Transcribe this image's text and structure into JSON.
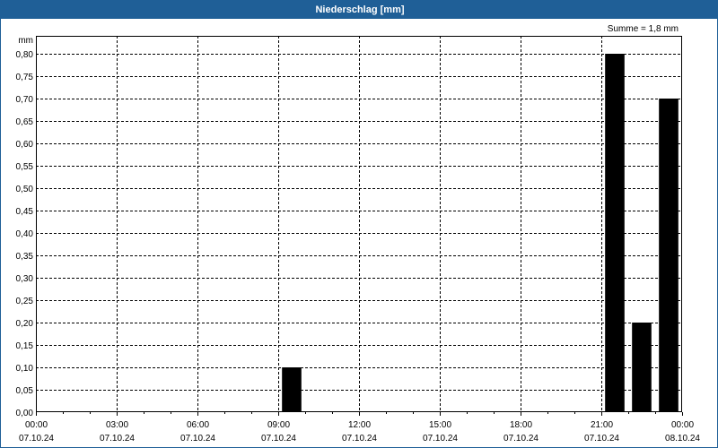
{
  "window": {
    "title": "Niederschlag [mm]"
  },
  "summary": {
    "text": "Summe = 1,8 mm"
  },
  "colors": {
    "titlebar": "#1f5f97",
    "bars": "#000000",
    "grid": "#000000"
  },
  "chart_data": {
    "type": "bar",
    "title": "Niederschlag [mm]",
    "ylabel": "mm",
    "xlabel": "",
    "ylim": [
      0,
      0.84
    ],
    "yticks": [
      0,
      0.05,
      0.1,
      0.15,
      0.2,
      0.25,
      0.3,
      0.35,
      0.4,
      0.45,
      0.5,
      0.55,
      0.6,
      0.65,
      0.7,
      0.75,
      0.8
    ],
    "ytick_labels": [
      "0,00",
      "0,05",
      "0,10",
      "0,15",
      "0,20",
      "0,25",
      "0,30",
      "0,35",
      "0,40",
      "0,45",
      "0,50",
      "0,55",
      "0,60",
      "0,65",
      "0,70",
      "0,75",
      "0,80"
    ],
    "xlim_hours": [
      0,
      24
    ],
    "xticks_hours": [
      0,
      3,
      6,
      9,
      12,
      15,
      18,
      21,
      24
    ],
    "xtick_time_labels": [
      "00:00",
      "03:00",
      "06:00",
      "09:00",
      "12:00",
      "15:00",
      "18:00",
      "21:00",
      "00:00"
    ],
    "xtick_date_labels": [
      "07.10.24",
      "07.10.24",
      "07.10.24",
      "07.10.24",
      "07.10.24",
      "07.10.24",
      "07.10.24",
      "07.10.24",
      "08.10.24"
    ],
    "grid": true,
    "bars": [
      {
        "start_hour": 9,
        "end_hour": 10,
        "value": 0.1
      },
      {
        "start_hour": 21,
        "end_hour": 22,
        "value": 0.8
      },
      {
        "start_hour": 22,
        "end_hour": 23,
        "value": 0.2
      },
      {
        "start_hour": 23,
        "end_hour": 24,
        "value": 0.7
      }
    ]
  }
}
